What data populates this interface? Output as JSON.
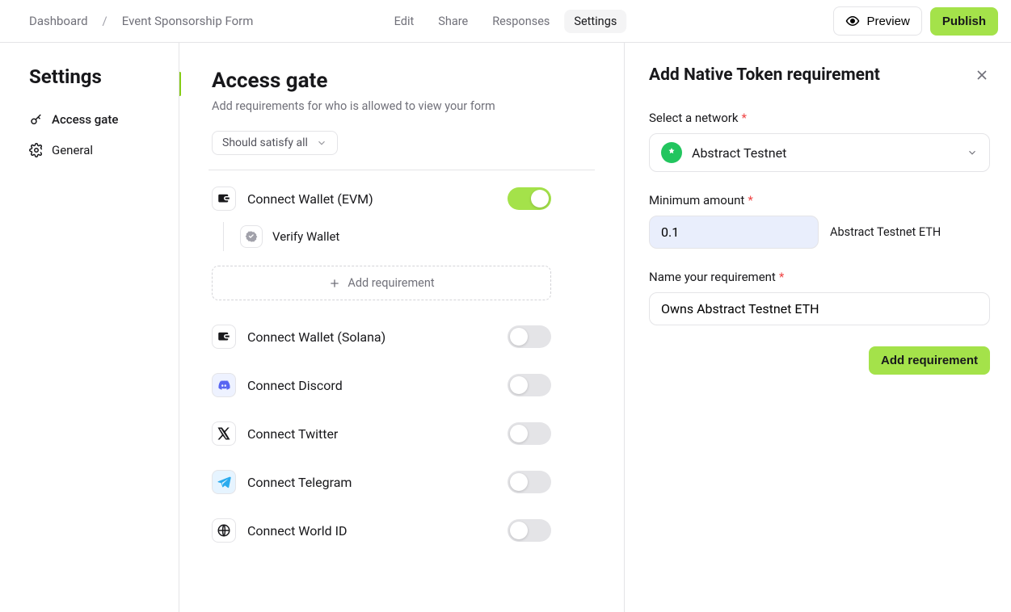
{
  "breadcrumbs": {
    "root": "Dashboard",
    "current": "Event Sponsorship Form"
  },
  "nav": {
    "items": [
      "Edit",
      "Share",
      "Responses",
      "Settings"
    ],
    "activeIndex": 3
  },
  "actions": {
    "preview": "Preview",
    "publish": "Publish"
  },
  "sidebar": {
    "title": "Settings",
    "items": [
      {
        "label": "Access gate"
      },
      {
        "label": "General"
      }
    ],
    "activeIndex": 0
  },
  "content": {
    "title": "Access gate",
    "subtitle": "Add requirements for who is allowed to view your form",
    "filter": "Should satisfy all",
    "gates": [
      {
        "label": "Connect Wallet (EVM)",
        "enabled": true,
        "children": [
          {
            "label": "Verify Wallet"
          }
        ],
        "addLabel": "Add requirement"
      },
      {
        "label": "Connect Wallet (Solana)",
        "enabled": false
      },
      {
        "label": "Connect Discord",
        "enabled": false
      },
      {
        "label": "Connect Twitter",
        "enabled": false
      },
      {
        "label": "Connect Telegram",
        "enabled": false
      },
      {
        "label": "Connect World ID",
        "enabled": false
      }
    ]
  },
  "panel": {
    "title": "Add Native Token requirement",
    "network": {
      "label": "Select a network",
      "value": "Abstract Testnet"
    },
    "amount": {
      "label": "Minimum amount",
      "value": "0.1",
      "unit": "Abstract Testnet ETH"
    },
    "name": {
      "label": "Name your requirement",
      "value": "Owns Abstract Testnet ETH"
    },
    "submit": "Add requirement"
  }
}
